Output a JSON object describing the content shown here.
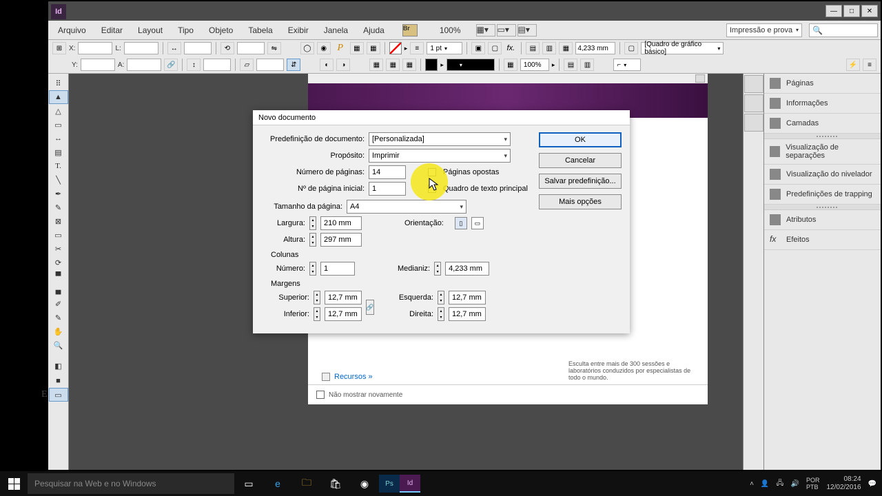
{
  "menu": {
    "items": [
      "Arquivo",
      "Editar",
      "Layout",
      "Tipo",
      "Objeto",
      "Tabela",
      "Exibir",
      "Janela",
      "Ajuda"
    ],
    "zoom": "100%",
    "workspace": "Impressão e prova"
  },
  "control": {
    "stroke_weight": "1 pt",
    "stroke_extra": "4,233 mm",
    "style_dd": "[Quadro de gráfico básico]",
    "opacity": "100%",
    "x_label": "X:",
    "y_label": "Y:",
    "l_label": "L:",
    "a_label": "A:"
  },
  "panels": [
    "Páginas",
    "Informações",
    "Camadas",
    "Visualização de separações",
    "Visualização do nivelador",
    "Predefinições de trapping",
    "Atributos",
    "Efeitos"
  ],
  "welcome": {
    "resources": "Recursos »",
    "dont_show": "Não mostrar novamente",
    "blurb": "Esculta entre mais de 300 sessões e laboratórios conduzidos por especialistas de todo o mundo."
  },
  "dialog": {
    "title": "Novo documento",
    "labels": {
      "preset": "Predefinição de documento:",
      "intent": "Propósito:",
      "pages": "Número de páginas:",
      "start": "Nº de página inicial:",
      "facing": "Páginas opostas",
      "frame": "Quadro de texto principal",
      "pagesize": "Tamanho da página:",
      "width": "Largura:",
      "height": "Altura:",
      "orient": "Orientação:",
      "columns_group": "Colunas",
      "col_num": "Número:",
      "gutter": "Medianiz:",
      "margins_group": "Margens",
      "m_top": "Superior:",
      "m_bottom": "Inferior:",
      "m_left": "Esquerda:",
      "m_right": "Direita:"
    },
    "values": {
      "preset": "[Personalizada]",
      "intent": "Imprimir",
      "pages": "14",
      "start": "1",
      "pagesize": "A4",
      "width": "210 mm",
      "height": "297 mm",
      "col_num": "1",
      "gutter": "4,233 mm",
      "m_top": "12,7 mm",
      "m_bottom": "12,7 mm",
      "m_left": "12,7 mm",
      "m_right": "12,7 mm"
    },
    "buttons": {
      "ok": "OK",
      "cancel": "Cancelar",
      "save": "Salvar predefinição...",
      "more": "Mais opções"
    }
  },
  "taskbar": {
    "search_placeholder": "Pesquisar na Web e no Windows",
    "time": "08:24",
    "date": "12/02/2016"
  }
}
